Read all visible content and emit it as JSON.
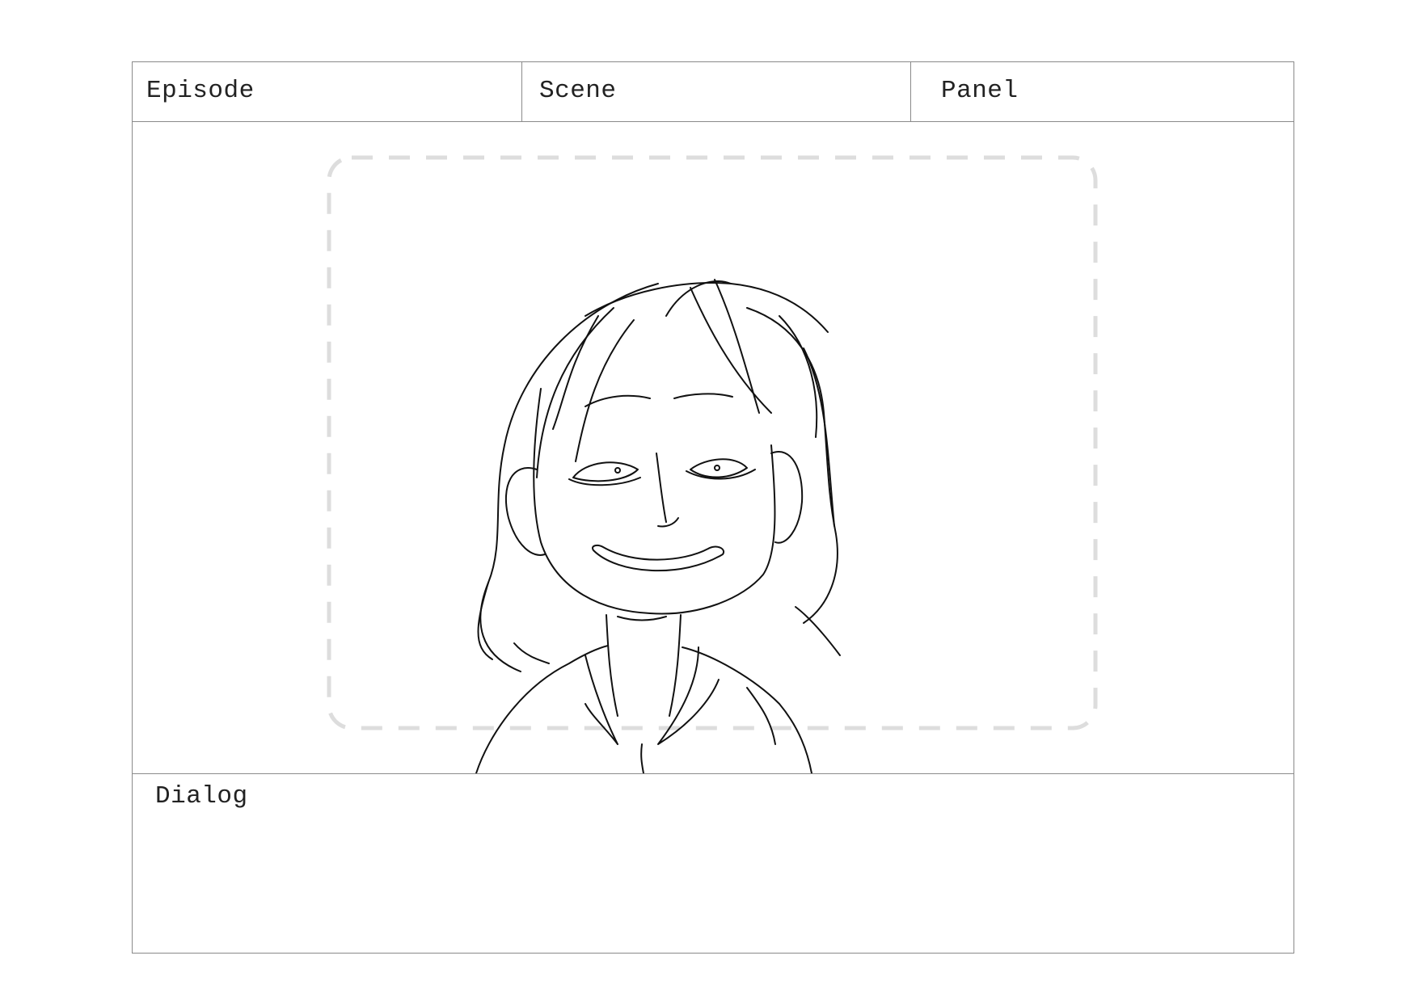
{
  "storyboard": {
    "header": {
      "episode_label": "Episode",
      "scene_label": "Scene",
      "panel_label": "Panel"
    },
    "frame": {
      "safe_area_style": "dashed rounded rectangle",
      "safe_area_color": "#dddddd",
      "sketch_subject": "smiling character bust sketch"
    },
    "dialog": {
      "label": "Dialog",
      "text": ""
    }
  },
  "colors": {
    "border": "#8a8a8a",
    "ink": "#111111",
    "guide": "#dddddd",
    "background": "#ffffff"
  }
}
